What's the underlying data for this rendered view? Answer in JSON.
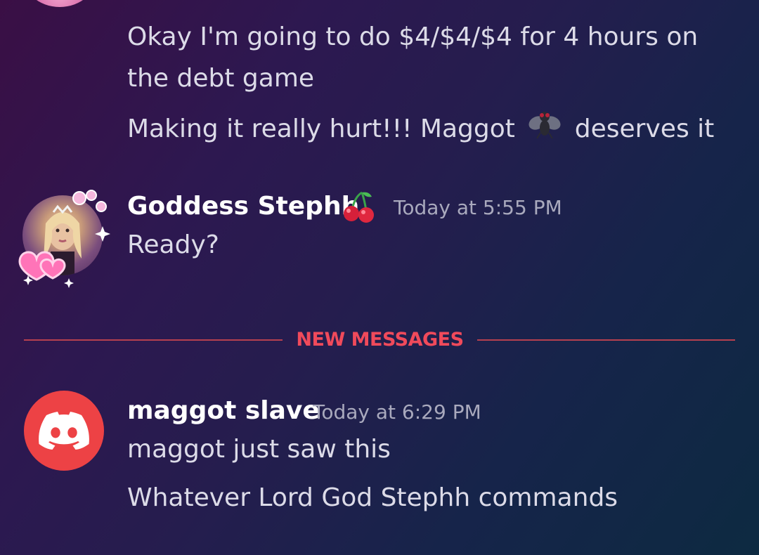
{
  "messages_top": {
    "line1": "Okay I'm going to do $4/$4/$4 for 4 hours on",
    "line2": "the debt game",
    "line3_before": "Making it really hurt!!! Maggot",
    "line3_after": "deserves it",
    "emoji_icon": "fly-emoji"
  },
  "message_goddess": {
    "username": "Goddess Stephh",
    "badge_icon": "cherries-emoji",
    "timestamp": "Today at 5:55 PM",
    "text": "Ready?"
  },
  "divider": {
    "label": "NEW MESSAGES",
    "color": "#f04a5b"
  },
  "message_slave": {
    "username": "maggot slave",
    "timestamp": "Today at 6:29 PM",
    "lines": [
      "maggot just saw this",
      "Whatever Lord God Stephh commands"
    ],
    "avatar_icon": "discord-logo-icon",
    "avatar_color": "#ed4245"
  }
}
